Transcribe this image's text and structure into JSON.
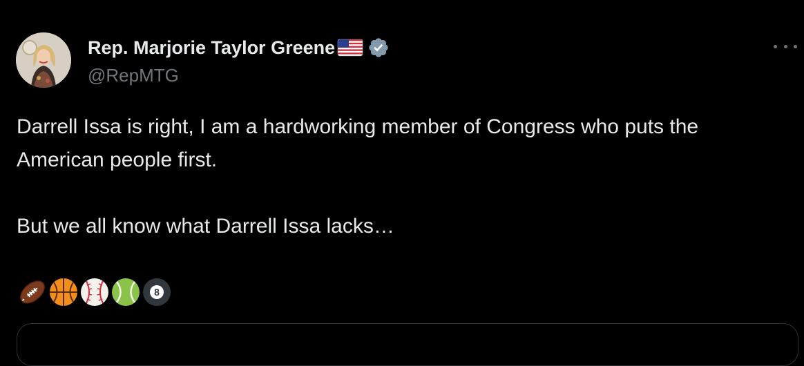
{
  "tweet": {
    "author_name": "Rep. Marjorie Taylor Greene",
    "handle": "@RepMTG",
    "flag_icon": "us-flag-icon",
    "verified_icon": "verified-badge-icon",
    "text_lines": [
      "Darrell Issa is right, I am a hardworking member of Congress who puts the American people first.",
      "But we all know what Darrell Issa lacks…"
    ],
    "emojis": [
      "american-football",
      "basketball",
      "baseball",
      "tennis-ball",
      "pool-8-ball"
    ]
  },
  "colors": {
    "background": "#000000",
    "text": "#e7e9ea",
    "secondary": "#71767b",
    "verified": "#829aab"
  }
}
